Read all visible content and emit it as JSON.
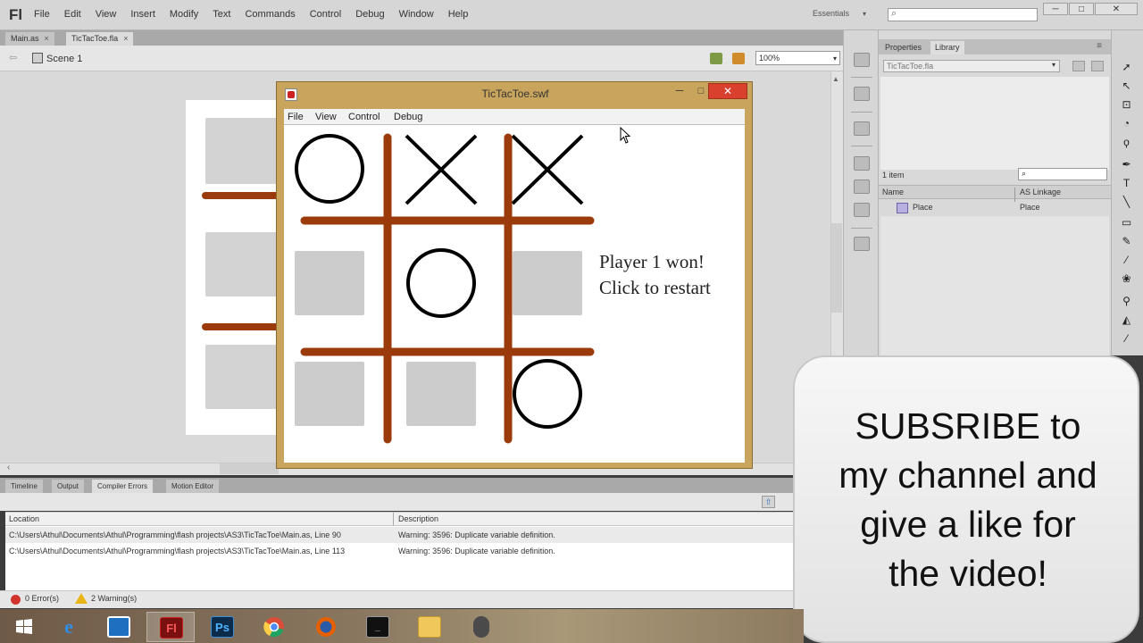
{
  "app": {
    "logo": "Fl",
    "menus": [
      "File",
      "Edit",
      "View",
      "Insert",
      "Modify",
      "Text",
      "Commands",
      "Control",
      "Debug",
      "Window",
      "Help"
    ],
    "workspace": "Essentials",
    "window_controls": {
      "minimize": "─",
      "maximize": "□",
      "close": "✕"
    }
  },
  "doc_tabs": [
    {
      "label": "Main.as",
      "close": "×"
    },
    {
      "label": "TicTacToe.fla",
      "close": "×"
    }
  ],
  "scene": {
    "label": "Scene 1",
    "zoom": "100%"
  },
  "swf_window": {
    "title": "TicTacToe.swf",
    "menus": [
      "File",
      "View",
      "Control",
      "Debug"
    ],
    "close": "✕",
    "minimize": "─",
    "maximize": "□",
    "board": [
      [
        "O",
        "X",
        "X"
      ],
      [
        "",
        "O",
        ""
      ],
      [
        "",
        "",
        "O"
      ]
    ],
    "status_line1": "Player 1 won!",
    "status_line2": "Click to restart",
    "colors": {
      "grid": "#9b3b0c",
      "empty_cell": "#cccccc",
      "mark": "#000000"
    }
  },
  "library": {
    "tabs": [
      "Properties",
      "Library"
    ],
    "document": "TicTacToe.fla",
    "item_count": "1 item",
    "columns": [
      "Name",
      "AS Linkage"
    ],
    "items": [
      {
        "name": "Place",
        "linkage": "Place"
      }
    ]
  },
  "bottom_panel": {
    "tabs": [
      "Timeline",
      "Output",
      "Compiler Errors",
      "Motion Editor"
    ],
    "columns": [
      "Location",
      "Description"
    ],
    "rows": [
      {
        "location": "C:\\Users\\Athul\\Documents\\Athul\\Programming\\flash projects\\AS3\\TicTacToe\\Main.as, Line 90",
        "description": "Warning: 3596: Duplicate variable definition."
      },
      {
        "location": "C:\\Users\\Athul\\Documents\\Athul\\Programming\\flash projects\\AS3\\TicTacToe\\Main.as, Line 113",
        "description": "Warning: 3596: Duplicate variable definition."
      }
    ],
    "errors": "0 Error(s)",
    "warnings": "2 Warning(s)"
  },
  "overlay": {
    "lines": [
      "SUBSRIBE to",
      "my channel and",
      "give a like for",
      "the video!"
    ]
  },
  "taskbar": {
    "apps": [
      "windows-start",
      "internet-explorer",
      "store",
      "flash-pro",
      "photoshop",
      "chrome",
      "firefox",
      "command-prompt",
      "file-explorer",
      "media-app"
    ],
    "flash_label": "Fl",
    "photoshop_label": "Ps"
  }
}
